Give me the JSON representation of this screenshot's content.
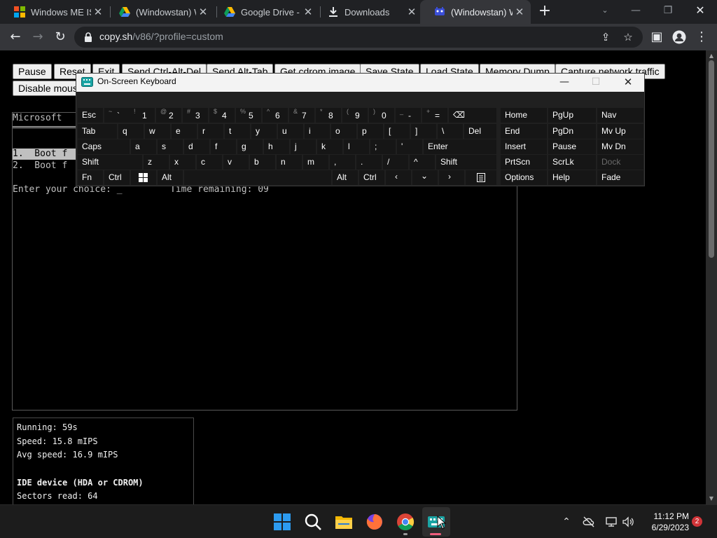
{
  "browser": {
    "tabs": [
      {
        "title": "Windows ME ISO"
      },
      {
        "title": "(Windowstan) W"
      },
      {
        "title": "Google Drive - Y"
      },
      {
        "title": "Downloads"
      },
      {
        "title": "(Windowstan) W"
      }
    ],
    "omnibox": {
      "host": "copy.sh",
      "path": "/v86/?profile=custom"
    }
  },
  "emulator": {
    "buttons": [
      "Pause",
      "Reset",
      "Exit",
      "Send Ctrl-Alt-Del",
      "Send Alt-Tab",
      "Get cdrom image",
      "Save State",
      "Load State",
      "Memory Dump",
      "Capture network traffic",
      "Disable mouse"
    ],
    "screen": {
      "title": "Microsoft",
      "option1": "1.  Boot f",
      "option2": "2.  Boot f",
      "prompt": "Enter your choice: _",
      "timer": "Time remaining: 09"
    },
    "stats": {
      "running": "Running: 59s",
      "speed": "Speed: 15.8 mIPS",
      "avg_speed": "Avg speed: 16.9 mIPS",
      "ide_title": "IDE device (HDA or CDROM)",
      "sectors": "Sectors read: 64"
    }
  },
  "osk": {
    "title": "On-Screen Keyboard",
    "row1": [
      {
        "main": "Esc",
        "shift": ""
      },
      {
        "main": "` ",
        "shift": "~"
      },
      {
        "main": "1",
        "shift": "!"
      },
      {
        "main": "2",
        "shift": "@"
      },
      {
        "main": "3",
        "shift": "#"
      },
      {
        "main": "4",
        "shift": "$"
      },
      {
        "main": "5",
        "shift": "%"
      },
      {
        "main": "6",
        "shift": "^"
      },
      {
        "main": "7",
        "shift": "&"
      },
      {
        "main": "8",
        "shift": "*"
      },
      {
        "main": "9",
        "shift": "("
      },
      {
        "main": "0",
        "shift": ")"
      },
      {
        "main": "-",
        "shift": "_"
      },
      {
        "main": "=",
        "shift": "+"
      },
      {
        "main": "⌫",
        "shift": ""
      }
    ],
    "row2": [
      "Tab",
      "q",
      "w",
      "e",
      "r",
      "t",
      "y",
      "u",
      "i",
      "o",
      "p",
      "[",
      "]",
      "\\",
      "Del"
    ],
    "row3": [
      "Caps",
      "a",
      "s",
      "d",
      "f",
      "g",
      "h",
      "j",
      "k",
      "l",
      ";",
      "'",
      "Enter"
    ],
    "row4": [
      "Shift",
      "z",
      "x",
      "c",
      "v",
      "b",
      "n",
      "m",
      ",",
      ".",
      "/",
      "^",
      "Shift"
    ],
    "row5": [
      "Fn",
      "Ctrl",
      "Alt",
      "Alt",
      "Ctrl"
    ],
    "nav": [
      "Home",
      "PgUp",
      "Nav",
      "End",
      "PgDn",
      "Mv Up",
      "Insert",
      "Pause",
      "Mv Dn",
      "PrtScn",
      "ScrLk",
      "Dock",
      "Options",
      "Help",
      "Fade"
    ]
  },
  "taskbar": {
    "time": "11:12 PM",
    "date": "6/29/2023",
    "notifications": "2"
  },
  "colors": {
    "chrome_dark": "#202124",
    "chrome_toolbar": "#35363a",
    "osk_bg": "#202020",
    "osk_key": "#161616",
    "taskbar": "#1c1c1c",
    "vga_text": "#c0c0c0"
  }
}
